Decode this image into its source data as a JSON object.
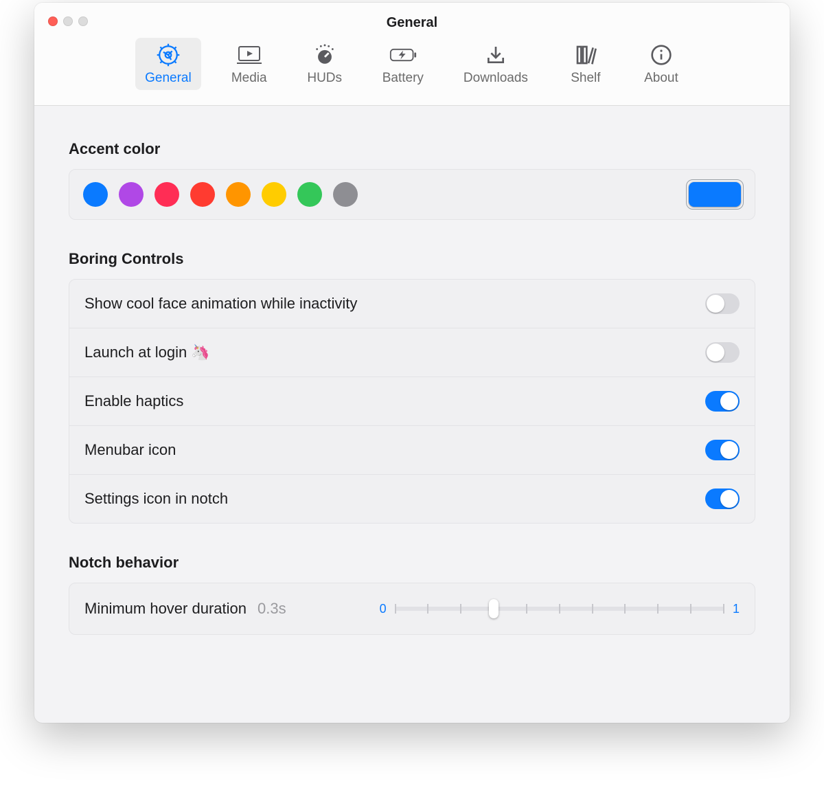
{
  "window": {
    "title": "General"
  },
  "toolbar": {
    "items": [
      {
        "label": "General",
        "active": true
      },
      {
        "label": "Media",
        "active": false
      },
      {
        "label": "HUDs",
        "active": false
      },
      {
        "label": "Battery",
        "active": false
      },
      {
        "label": "Downloads",
        "active": false
      },
      {
        "label": "Shelf",
        "active": false
      },
      {
        "label": "About",
        "active": false
      }
    ]
  },
  "sections": {
    "accent": {
      "title": "Accent color",
      "colors": [
        "#0a7aff",
        "#b048e6",
        "#ff2d55",
        "#ff3b30",
        "#ff9500",
        "#ffcc00",
        "#34c759",
        "#8e8e93"
      ],
      "selected_preview": "#0a7aff"
    },
    "boring": {
      "title": "Boring Controls",
      "rows": [
        {
          "label": "Show cool face animation while inactivity",
          "value": false
        },
        {
          "label": "Launch at login 🦄",
          "value": false
        },
        {
          "label": "Enable haptics",
          "value": true
        },
        {
          "label": "Menubar icon",
          "value": true
        },
        {
          "label": "Settings icon in notch",
          "value": true
        }
      ]
    },
    "notch": {
      "title": "Notch behavior",
      "hover": {
        "label": "Minimum hover duration",
        "value_display": "0.3s",
        "min_label": "0",
        "max_label": "1",
        "value": 0.3,
        "ticks": 11
      }
    }
  }
}
